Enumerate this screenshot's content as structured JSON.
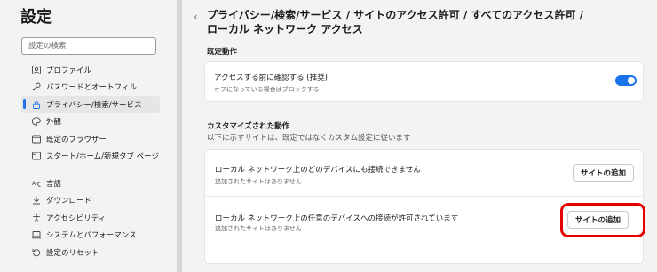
{
  "sidebar": {
    "title": "設定",
    "search_placeholder": "設定の検索",
    "items": [
      {
        "label": "プロファイル",
        "icon": "profile-icon"
      },
      {
        "label": "パスワードとオートフィル",
        "icon": "key-icon"
      },
      {
        "label": "プライバシー/検索/サービス",
        "icon": "lock-icon",
        "active": true
      },
      {
        "label": "外観",
        "icon": "palette-icon"
      },
      {
        "label": "既定のブラウザー",
        "icon": "browser-icon"
      },
      {
        "label": "スタート/ホーム/新規タブ ページ",
        "icon": "home-tab-icon"
      }
    ],
    "items2": [
      {
        "label": "言語",
        "icon": "language-icon"
      },
      {
        "label": "ダウンロード",
        "icon": "download-icon"
      },
      {
        "label": "アクセシビリティ",
        "icon": "accessibility-icon"
      },
      {
        "label": "システムとパフォーマンス",
        "icon": "system-icon"
      },
      {
        "label": "設定のリセット",
        "icon": "reset-icon"
      }
    ]
  },
  "main": {
    "breadcrumb_line1": "プライバシー/検索/サービス / サイトのアクセス許可 / すべてのアクセス許可 /",
    "breadcrumb_line2": "ローカル ネットワーク アクセス",
    "default_section": {
      "label": "既定動作",
      "title": "アクセスする前に確認する (推奨)",
      "desc": "オフになっている場合はブロックする",
      "toggle_on": true
    },
    "custom_section": {
      "label": "カスタマイズされた動作",
      "desc": "以下に示すサイトは、既定ではなくカスタム設定に従います",
      "rows": [
        {
          "title": "ローカル ネットワーク上のどのデバイスにも接続できません",
          "desc": "追加されたサイトはありません",
          "button": "サイトの追加"
        },
        {
          "title": "ローカル ネットワーク上の任意のデバイスへの接続が許可されています",
          "desc": "追加されたサイトはありません",
          "button": "サイトの追加"
        }
      ]
    }
  },
  "colors": {
    "accent": "#1a73e8",
    "highlight": "#e60000"
  }
}
